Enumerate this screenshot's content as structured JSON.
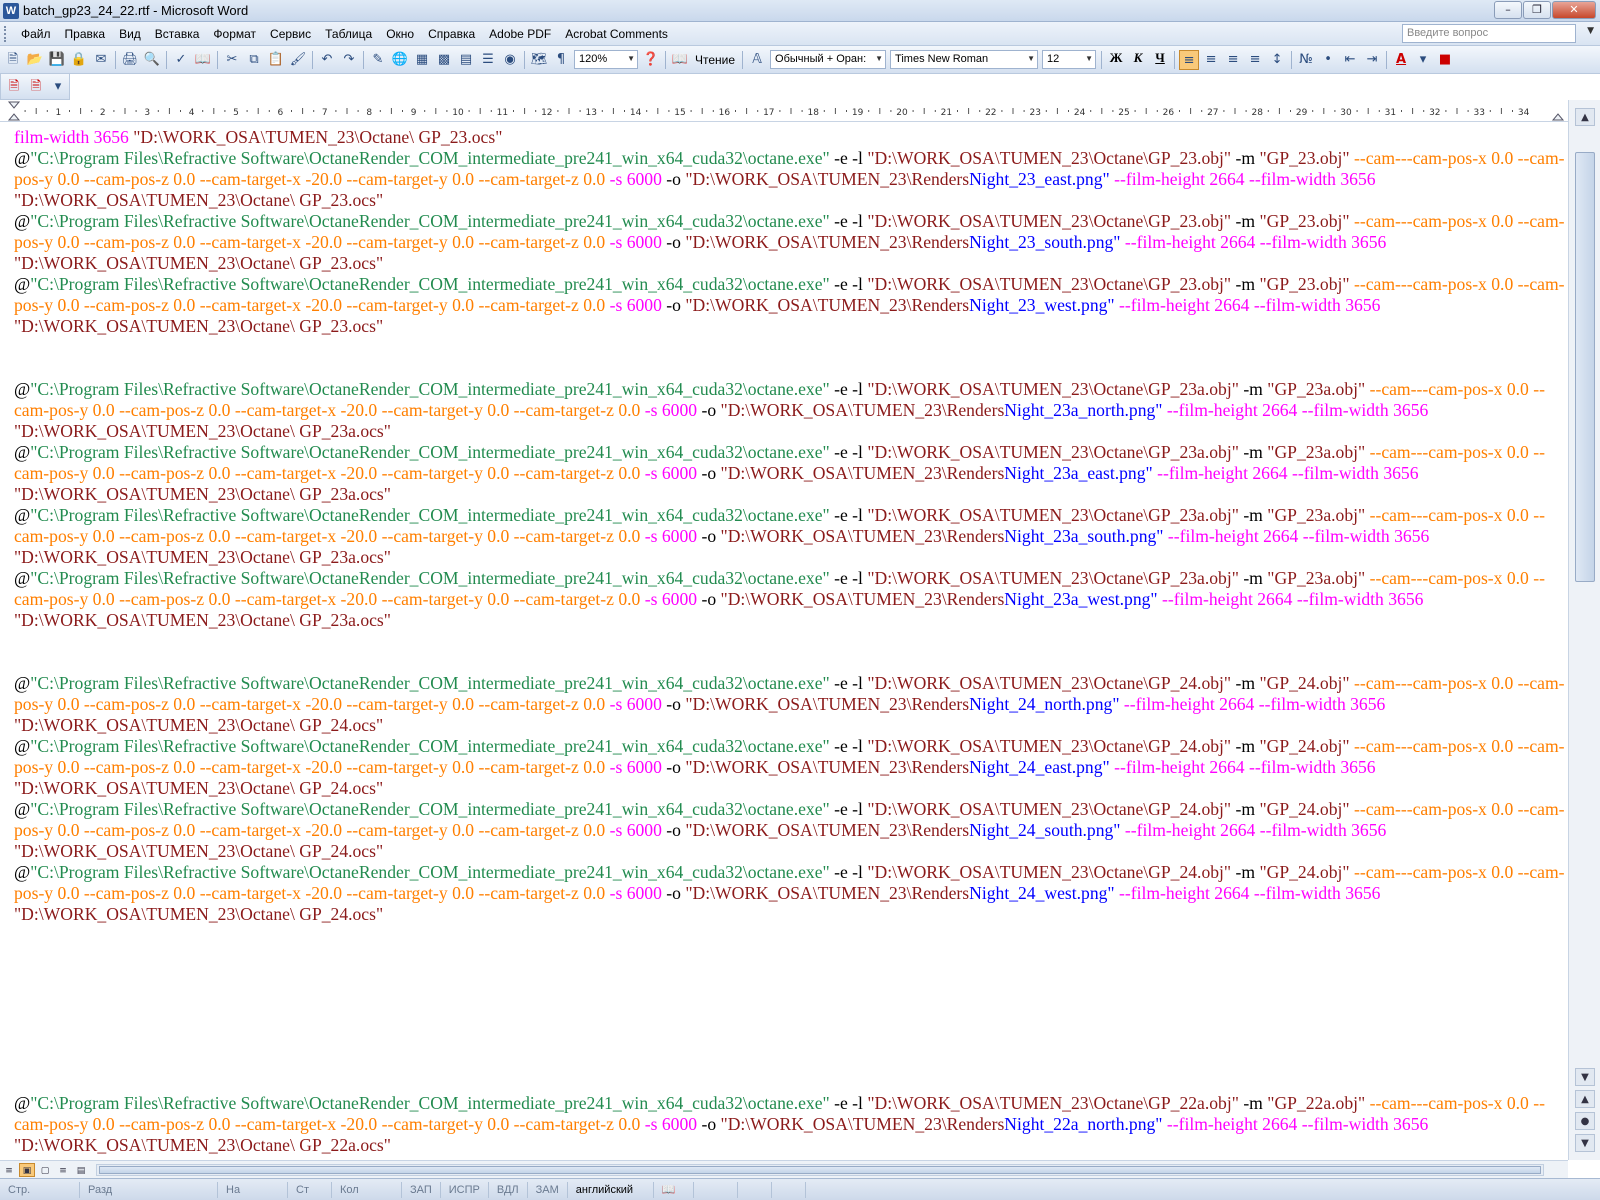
{
  "window": {
    "title": "batch_gp23_24_22.rtf - Microsoft Word",
    "app_icon": "W"
  },
  "menubar": {
    "items": [
      "Файл",
      "Правка",
      "Вид",
      "Вставка",
      "Формат",
      "Сервис",
      "Таблица",
      "Окно",
      "Справка",
      "Adobe PDF",
      "Acrobat Comments"
    ],
    "ask_placeholder": "Введите вопрос"
  },
  "toolbar": {
    "zoom": "120%",
    "reading_label": "Чтение",
    "style": "Обычный + Оран:",
    "font": "Times New Roman",
    "size": "12",
    "bold": "Ж",
    "italic": "К",
    "underline": "Ч"
  },
  "ruler": {
    "numbers": [
      "1",
      "2",
      "3",
      "4",
      "5",
      "6",
      "7",
      "8",
      "9",
      "10",
      "11",
      "12",
      "13",
      "14",
      "15",
      "16",
      "17",
      "18",
      "19",
      "20",
      "21",
      "22",
      "23",
      "24",
      "25",
      "26",
      "27",
      "28",
      "29",
      "30",
      "31",
      "32",
      "33",
      "34"
    ]
  },
  "document": {
    "first_line_tail": {
      "film": "film-width 3656",
      "ocs": " \"D:\\WORK_OSA\\TUMEN_23\\Octane\\ GP_23.ocs\""
    },
    "common": {
      "at": "@",
      "exe": "\"C:\\Program Files\\Refractive Software\\OctaneRender_COM_intermediate_pre241_win_x64_cuda32\\octane.exe\"",
      "e_l": " -e -l ",
      "m": " -m ",
      "cam_pos_x_opt": "--cam-pos-x ",
      "cam_pos_x_val": "0.0",
      "cam_pos_y_opt": " --cam-pos-y ",
      "cam_pos_y_val": "0.0",
      "cam_pos_z_opt": " --cam-pos-z ",
      "cam_pos_z_val": "0.0",
      "cam_target_x_opt": " --cam-target-x ",
      "cam_target_x_val": "-20.0",
      "cam_target_y_opt": " --cam-target-y ",
      "cam_target_y_val": "0.0",
      "cam_target_z_opt": " --cam-target-z ",
      "cam_target_z_val": "0.0",
      "s": " -s 6000",
      "o": " -o ",
      "renders": "\"D:\\WORK_OSA\\TUMEN_23\\Renders",
      "film_height": " --film-height 2664 --",
      "film_width": "film-width 3656",
      "ocs_prefix": " \"D:\\WORK_OSA\\TUMEN_23\\Octane\\ "
    },
    "commands": [
      {
        "obj_path": "\"D:\\WORK_OSA\\TUMEN_23\\Octane\\GP_23.obj\"",
        "mat": "\"GP_23.obj\"",
        "cam": " --cam-",
        "png": "Night_23_east.png\"",
        "ocs": "GP_23.ocs\""
      },
      {
        "obj_path": "\"D:\\WORK_OSA\\TUMEN_23\\Octane\\GP_23.obj\"",
        "mat": "\"GP_23.obj\"",
        "cam": " --cam-",
        "png": "Night_23_south.png\"",
        "ocs": "GP_23.ocs\""
      },
      {
        "obj_path": "\"D:\\WORK_OSA\\TUMEN_23\\Octane\\GP_23.obj\"",
        "mat": "\"GP_23.obj\"",
        "cam": " --cam-",
        "png": "Night_23_west.png\"",
        "ocs": "GP_23.ocs\""
      },
      {
        "obj_path": "\"D:\\WORK_OSA\\TUMEN_23\\Octane\\GP_23a.obj\"",
        "mat": "\"GP_23a.obj\"",
        "cam": " --cam-",
        "png": "Night_23a_north.png\"",
        "ocs": "GP_23a.ocs\""
      },
      {
        "obj_path": "\"D:\\WORK_OSA\\TUMEN_23\\Octane\\GP_23a.obj\"",
        "mat": "\"GP_23a.obj\"",
        "cam": " --cam-",
        "png": "Night_23a_east.png\"",
        "ocs": "GP_23a.ocs\""
      },
      {
        "obj_path": "\"D:\\WORK_OSA\\TUMEN_23\\Octane\\GP_23a.obj\"",
        "mat": "\"GP_23a.obj\"",
        "cam": " --cam-",
        "png": "Night_23a_south.png\"",
        "ocs": "GP_23a.ocs\""
      },
      {
        "obj_path": "\"D:\\WORK_OSA\\TUMEN_23\\Octane\\GP_23a.obj\"",
        "mat": "\"GP_23a.obj\"",
        "cam": " --cam-",
        "png": "Night_23a_west.png\"",
        "ocs": "GP_23a.ocs\""
      },
      {
        "obj_path": "\"D:\\WORK_OSA\\TUMEN_23\\Octane\\GP_24.obj\"",
        "mat": "\"GP_24.obj\"",
        "cam": " --cam-",
        "png": "Night_24_north.png\"",
        "ocs": "GP_24.ocs\""
      },
      {
        "obj_path": "\"D:\\WORK_OSA\\TUMEN_23\\Octane\\GP_24.obj\"",
        "mat": "\"GP_24.obj\"",
        "cam": " --cam-",
        "png": "Night_24_east.png\"",
        "ocs": "GP_24.ocs\""
      },
      {
        "obj_path": "\"D:\\WORK_OSA\\TUMEN_23\\Octane\\GP_24.obj\"",
        "mat": "\"GP_24.obj\"",
        "cam": " --cam-",
        "png": "Night_24_south.png\"",
        "ocs": "GP_24.ocs\""
      },
      {
        "obj_path": "\"D:\\WORK_OSA\\TUMEN_23\\Octane\\GP_24.obj\"",
        "mat": "\"GP_24.obj\"",
        "cam": " --cam-",
        "png": "Night_24_west.png\"",
        "ocs": "GP_24.ocs\""
      },
      {
        "obj_path": "\"D:\\WORK_OSA\\TUMEN_23\\Octane\\GP_22a.obj\"",
        "mat": "\"GP_22a.obj\"",
        "cam": " --cam-",
        "png": "Night_22a_north.png\"",
        "ocs": "GP_22a.ocs\""
      }
    ]
  },
  "statusbar": {
    "page": "Стр.",
    "section": "Разд",
    "at": "На",
    "line": "Ст",
    "col": "Кол",
    "rec": "ЗАП",
    "trk": "ИСПР",
    "ext": "ВДЛ",
    "ovr": "ЗАМ",
    "lang": "английский"
  },
  "colors": {
    "exe": "#228b4f",
    "option": "#ff7f00",
    "magenta": "#ff00ff",
    "path": "#8b1a1a",
    "png": "#0000ff"
  }
}
